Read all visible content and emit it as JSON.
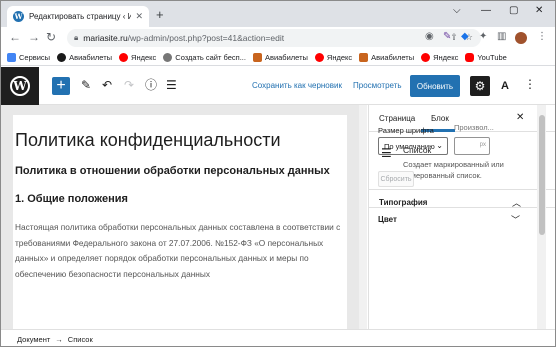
{
  "browser": {
    "tab_title": "Редактировать страницу ‹ ИЗУ…",
    "tab_close": "✕",
    "new_tab": "+",
    "window_controls": [
      "⌵",
      "—",
      "▢",
      "✕"
    ],
    "url_host": "mariasite.ru",
    "url_path": "/wp-admin/post.php?post=41&action=edit",
    "bookmarks": [
      {
        "label": "Сервисы",
        "color": "#4285f4"
      },
      {
        "label": "Авиабилеты",
        "color": "#1a1a1a"
      },
      {
        "label": "Яндекс",
        "color": "#ff0000"
      },
      {
        "label": "Создать сайт бесп...",
        "color": "#555555"
      },
      {
        "label": "Авиабилеты",
        "color": "#c8641e"
      },
      {
        "label": "Яндекс",
        "color": "#ff0000"
      },
      {
        "label": "Авиабилеты",
        "color": "#c8641e"
      },
      {
        "label": "Яндекс",
        "color": "#ff0000"
      },
      {
        "label": "YouTube",
        "color": "#ff0000"
      }
    ]
  },
  "editor": {
    "add_icon": "+",
    "save_draft": "Сохранить как черновик",
    "preview": "Просмотреть",
    "publish": "Обновить",
    "settings_icon": "⚙",
    "astra_icon": "A",
    "more_icon": "⋮"
  },
  "document": {
    "title": "Политика конфиденциальности",
    "subheading": "Политика в отношении обработки персональных данных",
    "section": "1. Общие положения",
    "paragraph": "Настоящая политика обработки персональных данных составлена в соответствии с требованиями Федерального закона от 27.07.2006. №152-ФЗ «О персональных данных» и определяет порядок обработки персональных данных и меры по обеспечению безопасности персональных данных"
  },
  "sidebar": {
    "tab_page": "Страница",
    "tab_block": "Блок",
    "close": "✕",
    "block_name": "Список",
    "block_desc": "Создает маркированный или нумерованный список.",
    "typography_title": "Типография",
    "font_size_label": "Размер шрифта",
    "custom_label": "Произвол...",
    "font_size_value": "По умолчанию",
    "custom_unit": "px",
    "reset": "Сбросить",
    "color_title": "Цвет"
  },
  "footer": {
    "breadcrumb_doc": "Документ",
    "separator": "→",
    "breadcrumb_block": "Список"
  },
  "colors": {
    "accent": "#2271b1",
    "dark": "#1e1e1e"
  }
}
